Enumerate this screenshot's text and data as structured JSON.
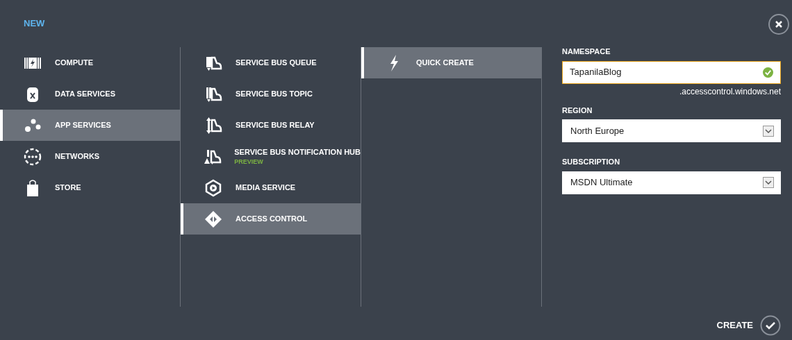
{
  "title": "NEW",
  "categories": [
    {
      "label": "COMPUTE",
      "selected": false
    },
    {
      "label": "DATA SERVICES",
      "selected": false
    },
    {
      "label": "APP SERVICES",
      "selected": true
    },
    {
      "label": "NETWORKS",
      "selected": false
    },
    {
      "label": "STORE",
      "selected": false
    }
  ],
  "services": [
    {
      "label": "SERVICE BUS QUEUE",
      "selected": false
    },
    {
      "label": "SERVICE BUS TOPIC",
      "selected": false
    },
    {
      "label": "SERVICE BUS RELAY",
      "selected": false
    },
    {
      "label": "SERVICE BUS NOTIFICATION HUB",
      "badge": "PREVIEW",
      "selected": false
    },
    {
      "label": "MEDIA SERVICE",
      "selected": false
    },
    {
      "label": "ACCESS CONTROL",
      "selected": true
    }
  ],
  "methods": [
    {
      "label": "QUICK CREATE",
      "selected": true
    }
  ],
  "form": {
    "namespace": {
      "label": "NAMESPACE",
      "value": "TapanilaBlog",
      "valid": true,
      "suffix": ".accesscontrol.windows.net"
    },
    "region": {
      "label": "REGION",
      "value": "North Europe"
    },
    "subscription": {
      "label": "SUBSCRIPTION",
      "value": "MSDN Ultimate"
    }
  },
  "create_button": "CREATE"
}
